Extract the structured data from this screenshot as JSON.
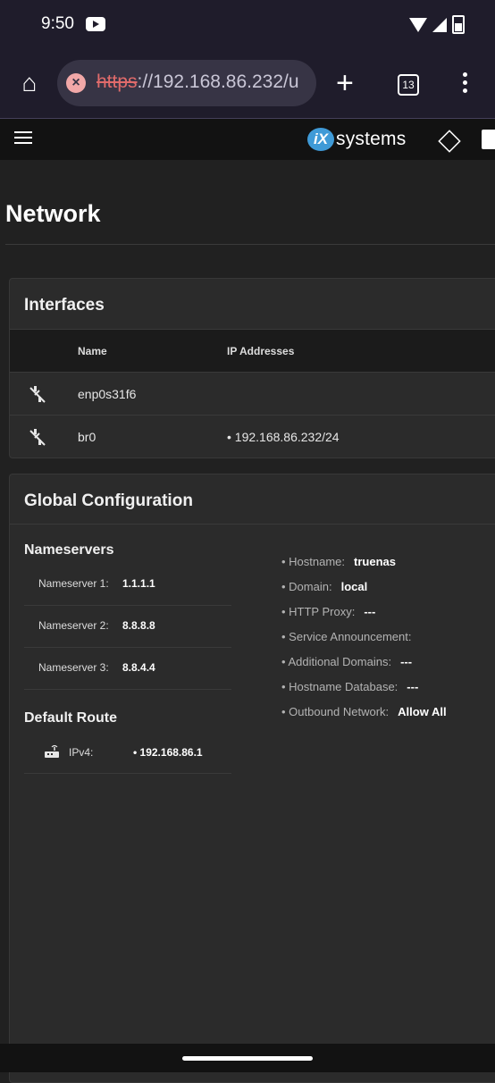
{
  "status_bar": {
    "time": "9:50"
  },
  "browser": {
    "url_scheme": "https",
    "url_rest": "://192.168.86.232/u",
    "tab_count": "13"
  },
  "app": {
    "logo_mark": "iX",
    "logo_text": "systems"
  },
  "page": {
    "title": "Network"
  },
  "interfaces": {
    "title": "Interfaces",
    "columns": {
      "name": "Name",
      "ip": "IP Addresses"
    },
    "rows": [
      {
        "name": "enp0s31f6",
        "ip": ""
      },
      {
        "name": "br0",
        "ip": "• 192.168.86.232/24"
      }
    ]
  },
  "global_config": {
    "title": "Global Configuration",
    "nameservers_title": "Nameservers",
    "nameservers": [
      {
        "label": "Nameserver 1:",
        "value": "1.1.1.1"
      },
      {
        "label": "Nameserver 2:",
        "value": "8.8.8.8"
      },
      {
        "label": "Nameserver 3:",
        "value": "8.8.4.4"
      }
    ],
    "default_route_title": "Default Route",
    "route": {
      "label": "IPv4:",
      "value": "• 192.168.86.1"
    },
    "info": [
      {
        "label": "• Hostname:",
        "value": "truenas"
      },
      {
        "label": "• Domain:",
        "value": "local"
      },
      {
        "label": "• HTTP Proxy:",
        "value": "---"
      },
      {
        "label": "• Service Announcement:",
        "value": ""
      },
      {
        "label": "• Additional Domains:",
        "value": "---"
      },
      {
        "label": "• Hostname Database:",
        "value": "---"
      },
      {
        "label": "• Outbound Network:",
        "value": "Allow All"
      }
    ]
  }
}
